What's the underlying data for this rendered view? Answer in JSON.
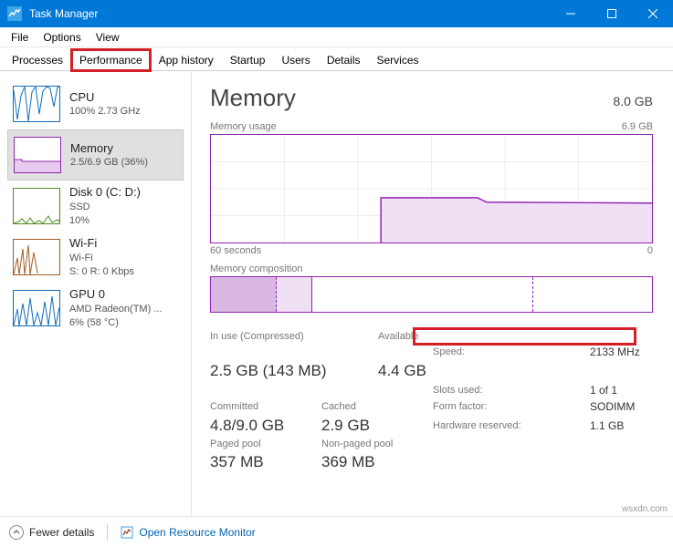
{
  "window": {
    "title": "Task Manager"
  },
  "menus": {
    "file": "File",
    "options": "Options",
    "view": "View"
  },
  "tabs": {
    "processes": "Processes",
    "performance": "Performance",
    "app_history": "App history",
    "startup": "Startup",
    "users": "Users",
    "details": "Details",
    "services": "Services"
  },
  "sidebar": {
    "cpu": {
      "name": "CPU",
      "sub": "100%  2.73 GHz"
    },
    "mem": {
      "name": "Memory",
      "sub": "2.5/6.9 GB (36%)"
    },
    "disk": {
      "name": "Disk 0 (C: D:)",
      "sub1": "SSD",
      "sub2": "10%"
    },
    "wifi": {
      "name": "Wi-Fi",
      "sub1": "Wi-Fi",
      "sub2": "S: 0 R: 0 Kbps"
    },
    "gpu": {
      "name": "GPU 0",
      "sub1": "AMD Radeon(TM) ...",
      "sub2": "6% (58 °C)"
    }
  },
  "main": {
    "title": "Memory",
    "capacity": "8.0 GB",
    "chart_caption": "Memory usage",
    "chart_max": "6.9 GB",
    "axis_left": "60 seconds",
    "axis_right": "0",
    "comp_caption": "Memory composition",
    "stats": {
      "in_use_label": "In use (Compressed)",
      "in_use_value": "2.5 GB (143 MB)",
      "available_label": "Available",
      "available_value": "4.4 GB",
      "committed_label": "Committed",
      "committed_value": "4.8/9.0 GB",
      "cached_label": "Cached",
      "cached_value": "2.9 GB",
      "paged_label": "Paged pool",
      "paged_value": "357 MB",
      "nonpaged_label": "Non-paged pool",
      "nonpaged_value": "369 MB"
    },
    "hardware": {
      "speed_label": "Speed:",
      "speed_value": "2133 MHz",
      "slots_label": "Slots used:",
      "slots_value": "1 of 1",
      "form_label": "Form factor:",
      "form_value": "SODIMM",
      "reserved_label": "Hardware reserved:",
      "reserved_value": "1.1 GB"
    }
  },
  "footer": {
    "fewer": "Fewer details",
    "open_rm": "Open Resource Monitor"
  },
  "watermark": "wsxdn.com",
  "chart_data": {
    "type": "area",
    "title": "Memory usage",
    "xlabel": "60 seconds → 0",
    "ylabel": "GB",
    "ylim": [
      0,
      6.9
    ],
    "x": [
      0,
      5,
      10,
      15,
      20,
      23,
      25,
      30,
      35,
      40,
      45,
      50,
      55,
      60
    ],
    "values": [
      0,
      0,
      0,
      0,
      0,
      2.8,
      2.8,
      2.8,
      2.8,
      2.6,
      2.5,
      2.5,
      2.5,
      2.5
    ]
  }
}
